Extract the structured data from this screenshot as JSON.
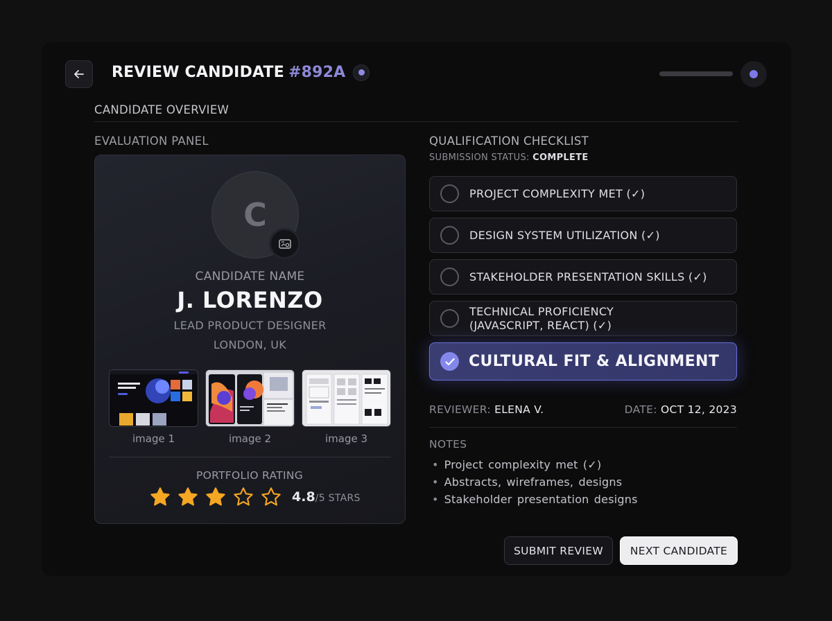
{
  "header": {
    "back_icon": "arrow-left-icon",
    "title": "REVIEW CANDIDATE",
    "title_id": "#892A"
  },
  "overview": {
    "label": "CANDIDATE OVERVIEW"
  },
  "evaluation_panel": {
    "label": "EVALUATION PANEL",
    "avatar_initial": "C",
    "avatar_edit_icon": "image-edit-icon",
    "candidate_label": "CANDIDATE NAME",
    "candidate_name": "J. LORENZO",
    "role": "LEAD PRODUCT DESIGNER",
    "location": "LONDON, UK",
    "portfolio": [
      {
        "caption": "image 1"
      },
      {
        "caption": "image 2"
      },
      {
        "caption": "image 3"
      }
    ],
    "rating": {
      "label": "PORTFOLIO RATING",
      "filled_stars": 3,
      "total_stars": 5,
      "value": "4.8",
      "suffix": "/5 STARS",
      "star_color": "#F5A623"
    }
  },
  "checklist": {
    "label": "QUALIFICATION CHECKLIST",
    "status_label": "SUBMISSION STATUS:",
    "status_value": "COMPLETE",
    "items": [
      {
        "label": "PROJECT COMPLEXITY MET (✓)",
        "checked": false
      },
      {
        "label": "DESIGN SYSTEM UTILIZATION (✓)",
        "checked": false
      },
      {
        "label": "STAKEHOLDER PRESENTATION SKILLS (✓)",
        "checked": false
      },
      {
        "label": "TECHNICAL PROFICIENCY",
        "label_line2": "(JAVASCRIPT, REACT) (✓)",
        "checked": false
      },
      {
        "label": "CULTURAL FIT & ALIGNMENT",
        "checked": true
      }
    ]
  },
  "meta": {
    "reviewer_label": "REVIEWER:",
    "reviewer": "ELENA V.",
    "date_label": "DATE:",
    "date": "OCT 12, 2023"
  },
  "notes": {
    "label": "NOTES",
    "items": [
      "Project complexity met (✓)",
      "Abstracts, wireframes, designs",
      "Stakeholder presentation designs"
    ]
  },
  "actions": {
    "submit": "SUBMIT REVIEW",
    "next": "NEXT CANDIDATE"
  },
  "colors": {
    "accent": "#8D88D6",
    "selected_item": "#3A3D72",
    "background": "#0C0C0D"
  }
}
